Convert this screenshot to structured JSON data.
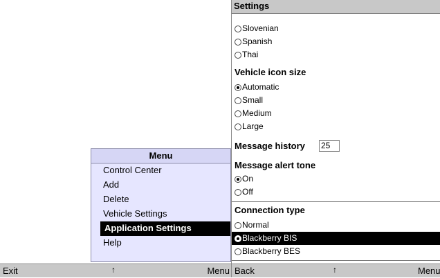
{
  "left": {
    "menu": {
      "title": "Menu",
      "items": [
        {
          "label": "Control Center"
        },
        {
          "label": "Add"
        },
        {
          "label": "Delete"
        },
        {
          "label": "Vehicle Settings"
        },
        {
          "label": "Application Settings",
          "selected": true
        },
        {
          "label": "Help"
        }
      ]
    },
    "softkeys": {
      "left": "Exit",
      "center": "↑",
      "right": "Menu"
    }
  },
  "right": {
    "title": "Settings",
    "languages": {
      "options": [
        {
          "label": "Slovenian",
          "checked": false
        },
        {
          "label": "Spanish",
          "checked": false
        },
        {
          "label": "Thai",
          "checked": false
        }
      ]
    },
    "vehicle_icon_size": {
      "label": "Vehicle icon size",
      "options": [
        {
          "label": "Automatic",
          "checked": true
        },
        {
          "label": "Small",
          "checked": false
        },
        {
          "label": "Medium",
          "checked": false
        },
        {
          "label": "Large",
          "checked": false
        }
      ]
    },
    "message_history": {
      "label": "Message history",
      "value": "25"
    },
    "message_alert_tone": {
      "label": "Message alert tone",
      "options": [
        {
          "label": "On",
          "checked": true
        },
        {
          "label": "Off",
          "checked": false
        }
      ]
    },
    "connection_type": {
      "label": "Connection type",
      "options": [
        {
          "label": "Normal",
          "checked": false
        },
        {
          "label": "Blackberry BIS",
          "checked": true,
          "highlighted": true
        },
        {
          "label": "Blackberry BES",
          "checked": false
        }
      ]
    },
    "softkeys": {
      "left": "Back",
      "center": "↑",
      "right": "Menu"
    }
  }
}
